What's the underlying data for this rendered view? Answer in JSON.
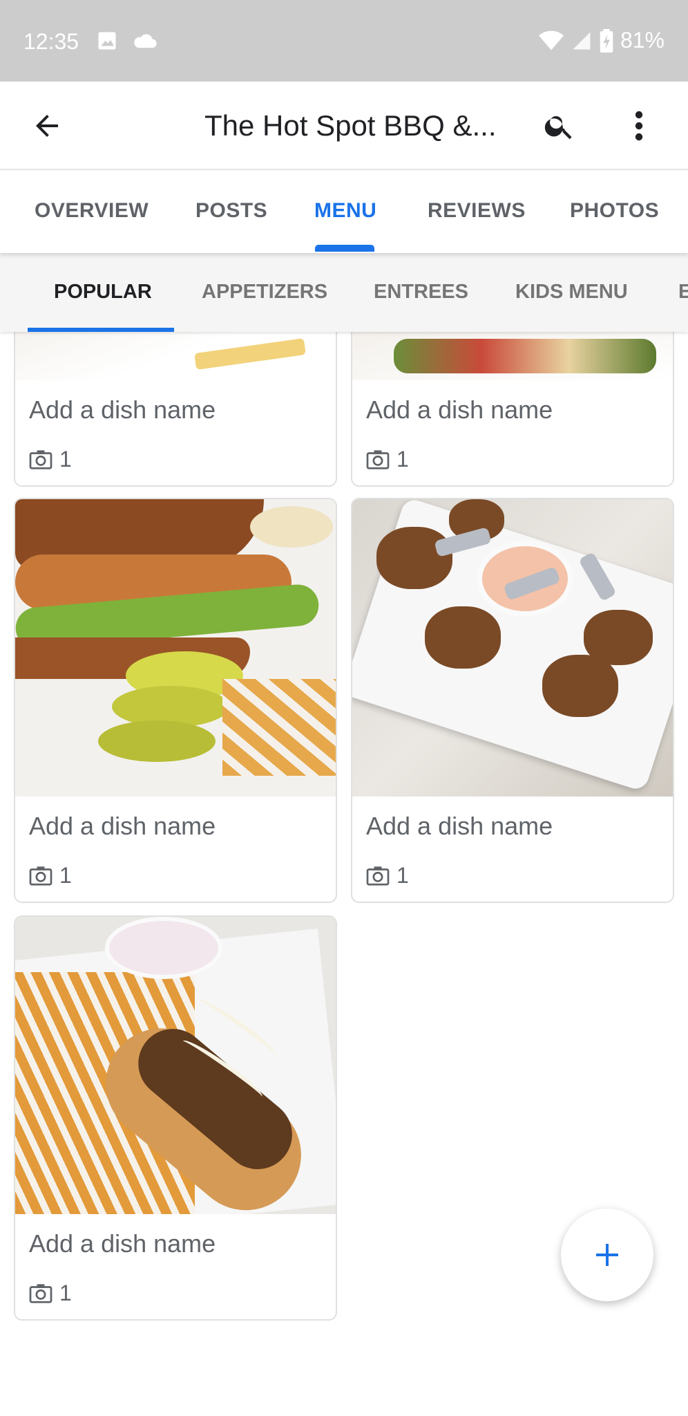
{
  "status_bar": {
    "time": "12:35",
    "battery": "81%"
  },
  "app_bar": {
    "title": "The Hot Spot BBQ &..."
  },
  "tabs": [
    {
      "label": "OVERVIEW",
      "active": false
    },
    {
      "label": "POSTS",
      "active": false
    },
    {
      "label": "MENU",
      "active": true
    },
    {
      "label": "REVIEWS",
      "active": false
    },
    {
      "label": "PHOTOS",
      "active": false
    }
  ],
  "subtabs": [
    {
      "label": "POPULAR",
      "active": true
    },
    {
      "label": "APPETIZERS",
      "active": false
    },
    {
      "label": "ENTREES",
      "active": false
    },
    {
      "label": "KIDS MENU",
      "active": false
    },
    {
      "label": "E",
      "active": false
    }
  ],
  "dishes": [
    {
      "name": "Add a dish name",
      "photo_count": "1"
    },
    {
      "name": "Add a dish name",
      "photo_count": "1"
    },
    {
      "name": "Add a dish name",
      "photo_count": "1"
    },
    {
      "name": "Add a dish name",
      "photo_count": "1"
    },
    {
      "name": "Add a dish name",
      "photo_count": "1"
    }
  ],
  "colors": {
    "accent": "#1a73e8",
    "status_bar": "#cccccc"
  },
  "icons": [
    "back-arrow-icon",
    "search-icon",
    "more-vert-icon",
    "camera-icon",
    "add-icon"
  ]
}
